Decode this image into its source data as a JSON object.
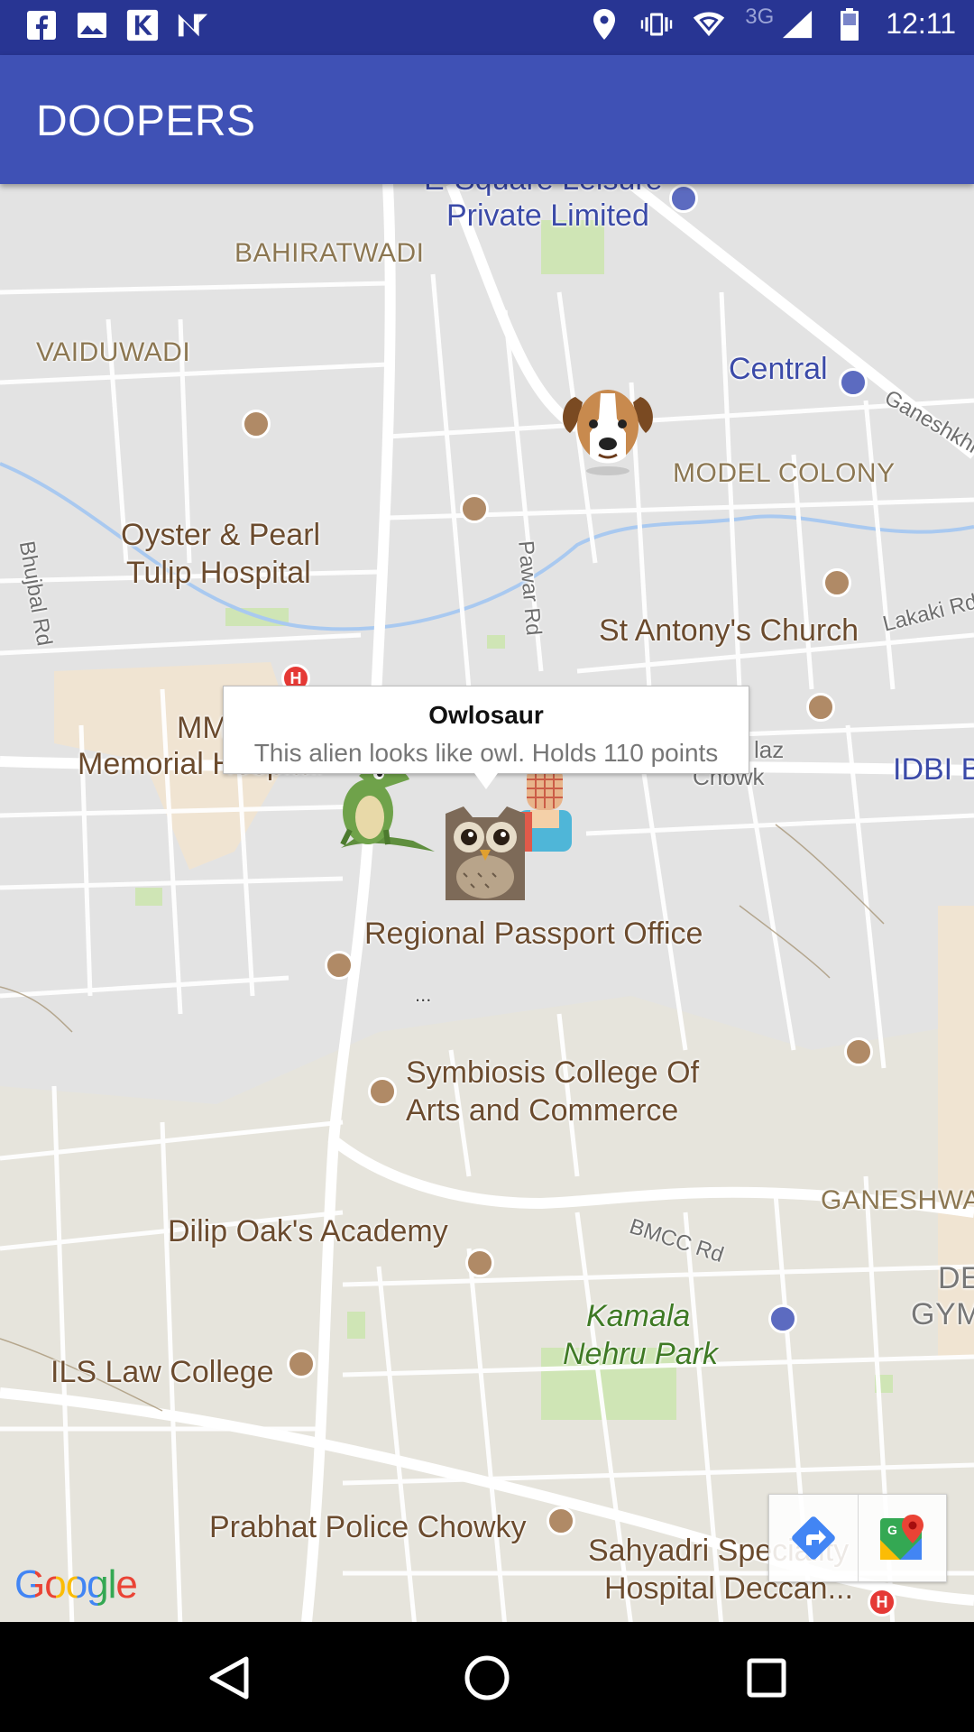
{
  "status_bar": {
    "time": "12:11",
    "network": "3G",
    "left_icons": [
      "facebook-icon",
      "image-icon",
      "k-app-icon",
      "n-app-icon"
    ],
    "right_icons": [
      "location-icon",
      "vibrate-icon",
      "wifi-icon",
      "signal-icon",
      "battery-icon"
    ]
  },
  "app_bar": {
    "title": "DOOPERS",
    "color": "#3f51b5"
  },
  "map": {
    "labels": {
      "e_square_1": "E-Square Leisure",
      "e_square_2": "Private Limited",
      "bahiratwadi": "BAHIRATWADI",
      "central": "Central",
      "ganeshkhind": "Ganeshkhi",
      "vaiduwadi": "VAIDUWADI",
      "model_colony": "MODEL COLONY",
      "oyster_1": "Oyster & Pearl",
      "oyster_2": "Tulip Hospital",
      "bhujbal_rd": "Bhujbal Rd",
      "pawar_rd": "Pawar Rd",
      "st_antony": "St Antony's Church",
      "lakaki_rd": "Lakaki Rd",
      "mm_1": "MM",
      "mm_2": "Memorial Hospital",
      "plaz_1": "laz",
      "plaz_2": "Chowk",
      "idbi": "IDBI B",
      "passport": "Regional Passport Office",
      "ellipsis": "...",
      "symbiosis_1": "Symbiosis College Of",
      "symbiosis_2": "Arts and Commerce",
      "ganeshwadi": "GANESHWA",
      "bmcc_rd": "BMCC Rd",
      "dilip_oak": "Dilip Oak's Academy",
      "de_gym_1": "DE",
      "de_gym_2": "GYM",
      "kamala_1": "Kamala",
      "kamala_2": "Nehru Park",
      "ils": "ILS Law College",
      "prabhat": "Prabhat Police Chowky",
      "sahyadri_1": "Sahyadri Speciality",
      "sahyadri_2": "Hospital Deccan..."
    },
    "markers": [
      "dog-marker",
      "crocodile-marker",
      "owl-marker",
      "person-marker"
    ],
    "info_window": {
      "title": "Owlosaur",
      "snippet": "This alien looks like owl. Holds 110 points"
    },
    "attribution": "Google"
  },
  "map_toolbar": [
    "directions-icon",
    "google-maps-icon"
  ],
  "nav_bar": [
    "back-icon",
    "home-icon",
    "recents-icon"
  ]
}
